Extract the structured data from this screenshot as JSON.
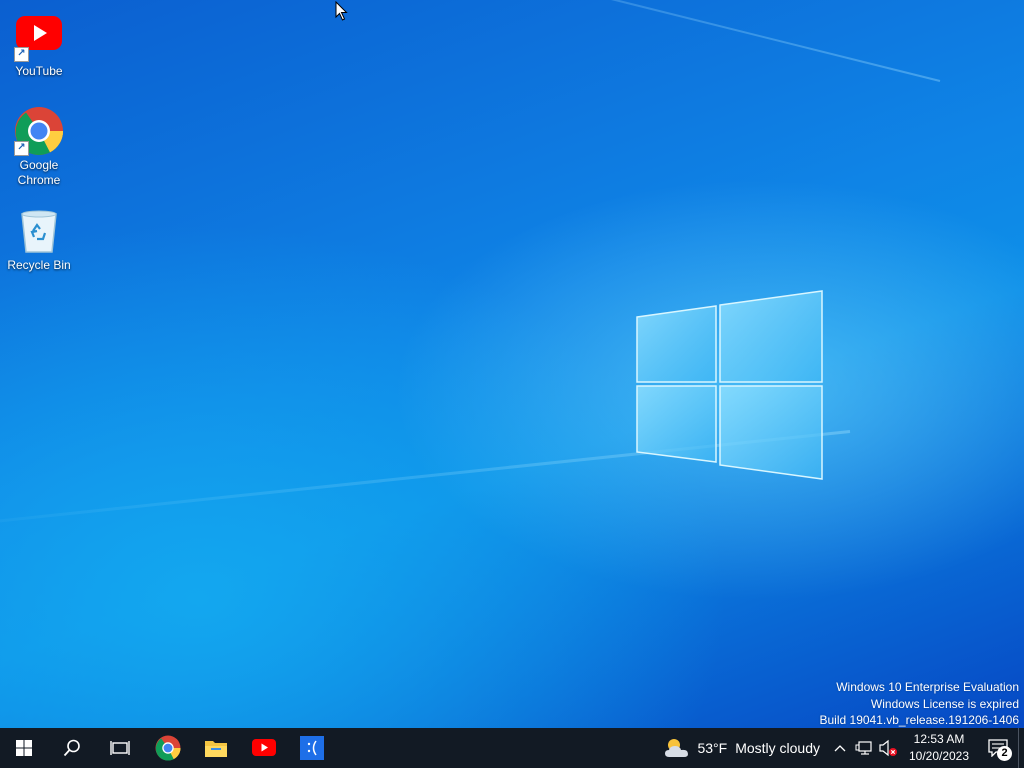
{
  "desktop_icons": [
    {
      "label": "YouTube",
      "icon": "youtube-icon"
    },
    {
      "label": "Google Chrome",
      "icon": "chrome-icon"
    },
    {
      "label": "Recycle Bin",
      "icon": "recycle-bin-icon"
    }
  ],
  "watermark": {
    "line1": "Windows 10 Enterprise Evaluation",
    "line2": "Windows License is expired",
    "line3": "Build 19041.vb_release.191206-1406"
  },
  "taskbar": {
    "pinned": [
      "start-icon",
      "search-icon",
      "task-view-icon",
      "chrome-icon",
      "file-explorer-icon",
      "youtube-icon",
      "sad-face-app-icon"
    ]
  },
  "tray": {
    "weather_temp": "53°F",
    "weather_condition": "Mostly cloudy",
    "time": "12:53 AM",
    "date": "10/20/2023",
    "notification_count": "2"
  },
  "colors": {
    "accent": "#0a6fd8",
    "taskbar": "#121a24",
    "youtube_red": "#ff0000"
  }
}
